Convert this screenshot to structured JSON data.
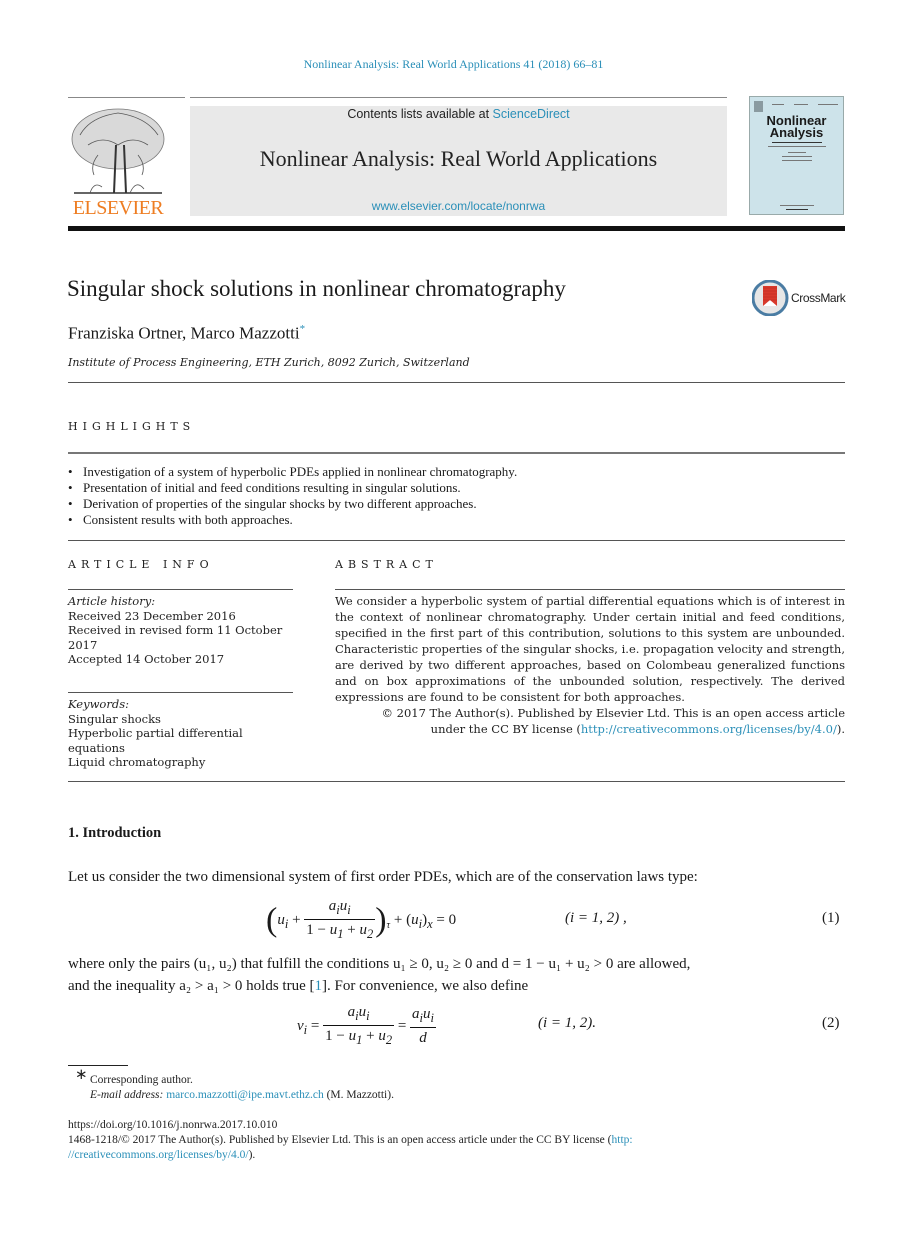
{
  "header": {
    "journal_reference": "Nonlinear Analysis: Real World Applications 41 (2018) 66–81",
    "contents_prefix": "Contents lists available at ",
    "contents_link": "ScienceDirect",
    "journal_title": "Nonlinear Analysis: Real World Applications",
    "journal_url": "www.elsevier.com/locate/nonrwa",
    "publisher_logo_text": "ELSEVIER",
    "cover_title_line1": "Nonlinear",
    "cover_title_line2": "Analysis"
  },
  "colors": {
    "link": "#2a8fb8",
    "elsevier_orange": "#ee7d22",
    "banner_gray": "#e9e9e9",
    "cover_blue": "#cde3ea"
  },
  "article": {
    "title": "Singular shock solutions in nonlinear chromatography",
    "crossmark_label": "CrossMark",
    "authors": "Franziska Ortner, Marco Mazzotti",
    "corresponding_mark": "*",
    "affiliation": "Institute of Process Engineering, ETH Zurich, 8092 Zurich, Switzerland"
  },
  "highlights": {
    "heading": "HIGHLIGHTS",
    "items": [
      "Investigation of a system of hyperbolic PDEs applied in nonlinear chromatography.",
      "Presentation of initial and feed conditions resulting in singular solutions.",
      "Derivation of properties of the singular shocks by two different approaches.",
      "Consistent results with both approaches."
    ]
  },
  "article_info": {
    "heading": "ARTICLE INFO",
    "history_label": "Article history:",
    "history": [
      "Received 23 December 2016",
      "Received in revised form 11 October 2017",
      "Accepted 14 October 2017"
    ],
    "keywords_label": "Keywords:",
    "keywords": [
      "Singular shocks",
      "Hyperbolic partial differential equations",
      "Liquid chromatography"
    ]
  },
  "abstract": {
    "heading": "ABSTRACT",
    "text": "We consider a hyperbolic system of partial differential equations which is of interest in the context of nonlinear chromatography. Under certain initial and feed conditions, specified in the first part of this contribution, solutions to this system are unbounded. Characteristic properties of the singular shocks, i.e. propagation velocity and strength, are derived by two different approaches, based on Colombeau generalized functions and on box approximations of the unbounded solution, respectively. The derived expressions are found to be consistent for both approaches.",
    "copyright_line1": "© 2017 The Author(s). Published by Elsevier Ltd. This is an open access article",
    "copyright_line2_prefix": "under the CC BY license (",
    "license_link": "http://creativecommons.org/licenses/by/4.0/",
    "copyright_line2_suffix": ")."
  },
  "introduction": {
    "heading": "1.  Introduction",
    "paragraph1": "Let us consider the two dimensional system of first order PDEs, which are of the conservation laws type:",
    "eq1": {
      "lhs_open": "u",
      "num": "a",
      "den": "1 − u",
      "rest": "+ (u",
      "cond": "(i = 1, 2) ,",
      "number": "(1)"
    },
    "paragraph2_line1": "where only the pairs (u₁, u₂) that fulfill the conditions u₁ ≥ 0, u₂ ≥ 0 and d = 1 − u₁ + u₂ > 0 are allowed,",
    "paragraph2_line2_prefix": "and the inequality a₂ > a₁ > 0 holds true [",
    "citation": "1",
    "paragraph2_line2_suffix": "]. For convenience, we also define",
    "eq2": {
      "cond": "(i = 1, 2).",
      "number": "(2)"
    }
  },
  "footer": {
    "star": "∗",
    "corresponding": "Corresponding author.",
    "email_label": "E-mail address: ",
    "email": "marco.mazzotti@ipe.mavt.ethz.ch",
    "email_suffix": " (M. Mazzotti).",
    "doi": "https://doi.org/10.1016/j.nonrwa.2017.10.010",
    "issn_line": "1468-1218/© 2017 The Author(s).  Published by Elsevier Ltd. This is an open access article under the CC BY license (",
    "license_link_part1": "http:",
    "license_link_part2": "//creativecommons.org/licenses/by/4.0/",
    "license_suffix": ")."
  }
}
